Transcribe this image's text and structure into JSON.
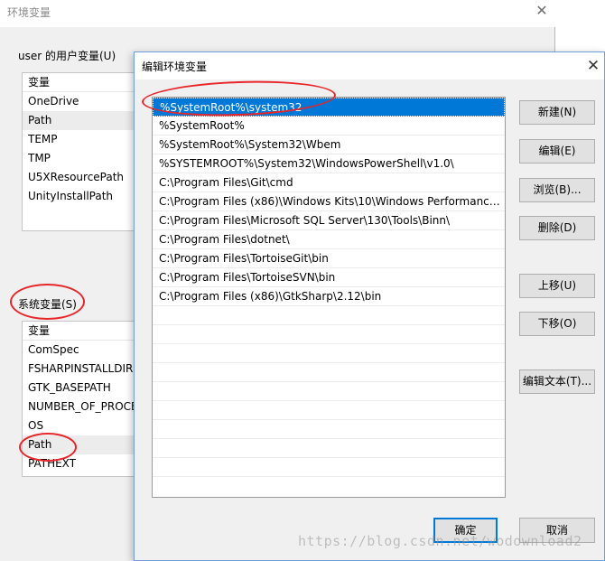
{
  "background_window": {
    "title": "环境变量",
    "close_glyph": "✕",
    "user_group_label": "user 的用户变量(U)",
    "user_list_header": "变量",
    "user_vars": [
      "OneDrive",
      "Path",
      "TEMP",
      "TMP",
      "U5XResourcePath",
      "UnityInstallPath"
    ],
    "system_group_label": "系统变量(S)",
    "system_list_header": "变量",
    "system_vars": [
      "ComSpec",
      "FSHARPINSTALLDIR",
      "GTK_BASEPATH",
      "NUMBER_OF_PROCE",
      "OS",
      "Path",
      "PATHEXT"
    ]
  },
  "dialog": {
    "title": "编辑环境变量",
    "close_glyph": "✕",
    "paths": [
      "%SystemRoot%\\system32",
      "%SystemRoot%",
      "%SystemRoot%\\System32\\Wbem",
      "%SYSTEMROOT%\\System32\\WindowsPowerShell\\v1.0\\",
      "C:\\Program Files\\Git\\cmd",
      "C:\\Program Files (x86)\\Windows Kits\\10\\Windows Performance ...",
      "C:\\Program Files\\Microsoft SQL Server\\130\\Tools\\Binn\\",
      "C:\\Program Files\\dotnet\\",
      "C:\\Program Files\\TortoiseGit\\bin",
      "C:\\Program Files\\TortoiseSVN\\bin",
      "C:\\Program Files (x86)\\GtkSharp\\2.12\\bin"
    ],
    "buttons": {
      "new": "新建(N)",
      "edit": "编辑(E)",
      "browse": "浏览(B)...",
      "delete": "删除(D)",
      "move_up": "上移(U)",
      "move_down": "下移(O)",
      "edit_text": "编辑文本(T)...",
      "ok": "确定",
      "cancel": "取消"
    }
  },
  "watermark": "https://blog.csdn.net/wodownload2",
  "colors": {
    "selection": "#0078d7",
    "annotation": "#e8262a"
  }
}
